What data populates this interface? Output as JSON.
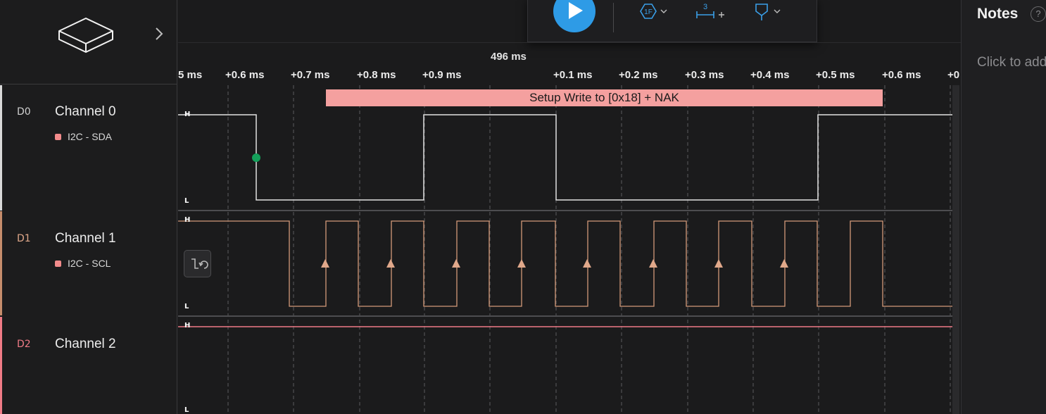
{
  "channels": [
    {
      "id": "D0",
      "name": "Channel 0",
      "analyzer": "I2C - SDA",
      "color": "#d9d9d9"
    },
    {
      "id": "D1",
      "name": "Channel 1",
      "analyzer": "I2C - SCL",
      "color": "#e0a88a"
    },
    {
      "id": "D2",
      "name": "Channel 2",
      "color": "#f07b86"
    }
  ],
  "timeline": {
    "center_label": "496 ms",
    "ticks": [
      "5 ms",
      "+0.6 ms",
      "+0.7 ms",
      "+0.8 ms",
      "+0.9 ms",
      "+0.1 ms",
      "+0.2 ms",
      "+0.3 ms",
      "+0.4 ms",
      "+0.5 ms",
      "+0.6 ms",
      "+0"
    ]
  },
  "annotation": {
    "label": "Setup Write to [0x18] + NAK",
    "color": "#f4a09f"
  },
  "levels": {
    "high": "H",
    "low": "L"
  },
  "toolbar": {
    "trigger_badge": "1F",
    "measure_badge": "3"
  },
  "notes": {
    "title": "Notes",
    "help": "?",
    "placeholder": "Click to add"
  },
  "colors": {
    "accent": "#2e9be6",
    "background": "#1b1b1c",
    "start_marker": "#14a05a"
  }
}
